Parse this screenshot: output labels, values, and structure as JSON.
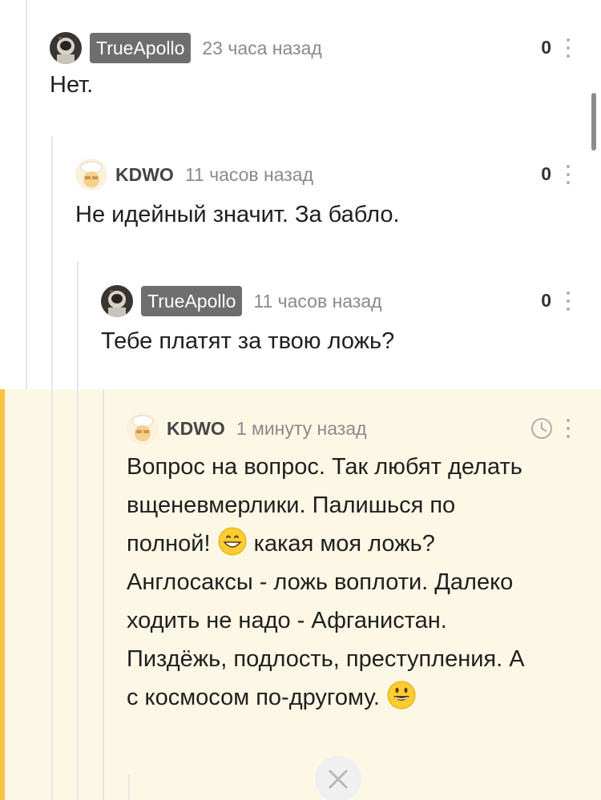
{
  "comments": [
    {
      "author": "TrueApollo",
      "author_style": "badge",
      "time": "23 часа назад",
      "rating": "0",
      "text": "Нет."
    },
    {
      "author": "KDWO",
      "author_style": "plain",
      "time": "11 часов назад",
      "rating": "0",
      "text": "Не идейный значит. За бабло."
    },
    {
      "author": "TrueApollo",
      "author_style": "badge",
      "time": "11 часов назад",
      "rating": "0",
      "text": "Тебе платят за твою ложь?"
    },
    {
      "author": "KDWO",
      "author_style": "plain",
      "time": "1 минуту назад",
      "status_icon": "clock-icon",
      "text_lines": [
        "Вопрос на вопрос. Так любят делать",
        "вщеневмерлики. Палишься по",
        "полной!",
        "какая моя ложь?",
        "Англосаксы - ложь воплоти. Далеко",
        "ходить не надо - Афганистан.",
        "Пиздёжь, подлость, преступления.  А",
        "с космосом по-другому."
      ]
    }
  ],
  "colors": {
    "highlight_bg": "#fdf8e6",
    "highlight_bar": "#f5c542",
    "badge_bg": "#6e6e6e"
  }
}
